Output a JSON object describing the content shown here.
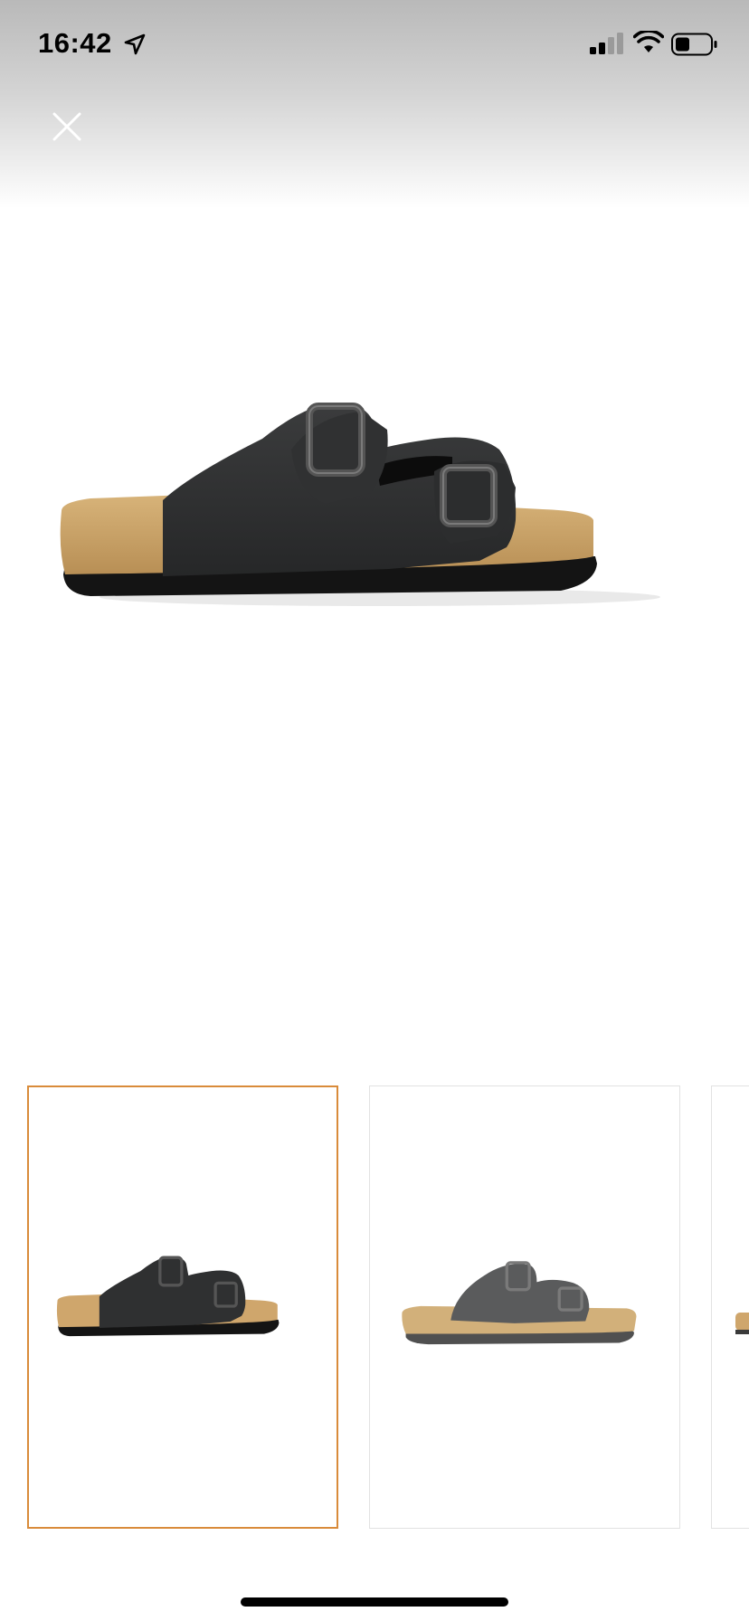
{
  "status_bar": {
    "time": "16:42",
    "location_icon": "location-arrow-icon",
    "signal_icon": "cellular-signal-icon",
    "wifi_icon": "wifi-icon",
    "battery_icon": "battery-icon"
  },
  "header": {
    "close_icon": "close-icon"
  },
  "gallery": {
    "main_image": "sandal-black-side-view",
    "thumbnails": [
      {
        "image": "sandal-black-side-view",
        "selected": true
      },
      {
        "image": "sandal-black-angled-view",
        "selected": false
      },
      {
        "image": "sandal-partial-view",
        "selected": false
      }
    ]
  },
  "colors": {
    "selected_border": "#d98b3a",
    "thumb_border": "#e2e2e2",
    "cork": "#c9a46b",
    "upper": "#2e2f30"
  }
}
